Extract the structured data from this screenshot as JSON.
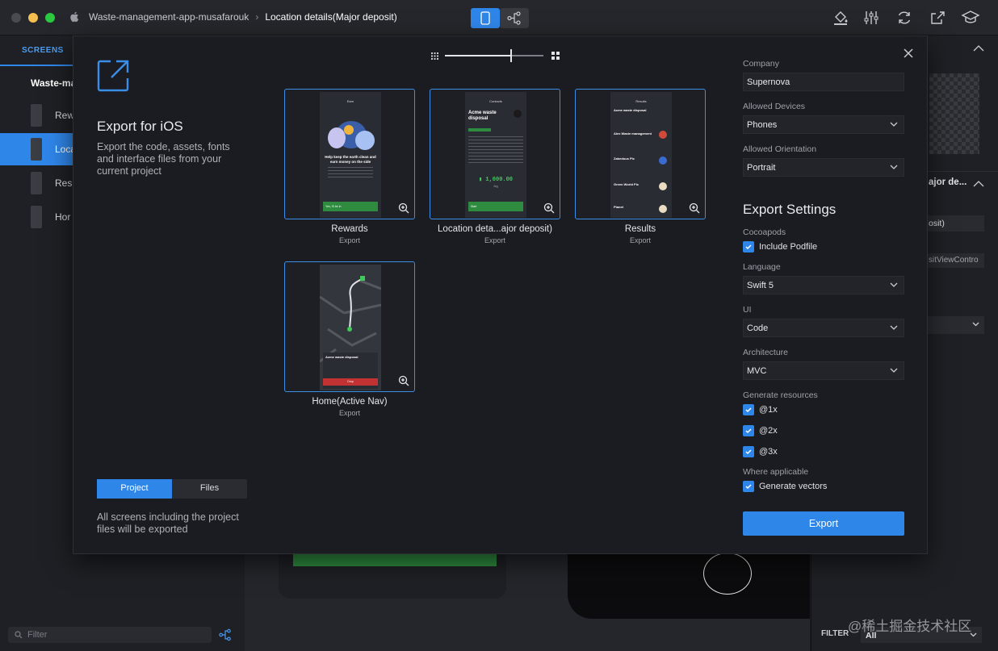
{
  "window": {
    "project_path": "Waste-management-app-musafarouk",
    "current_screen": "Location details(Major deposit)"
  },
  "left_panel": {
    "tab_label": "SCREENS",
    "project_name": "Waste-ma",
    "screens": [
      {
        "label": "Rew",
        "selected": false
      },
      {
        "label": "Loca",
        "selected": true
      },
      {
        "label": "Res",
        "selected": false
      },
      {
        "label": "Hor",
        "selected": false
      }
    ],
    "filter_placeholder": "Filter"
  },
  "right_panel_fragments": {
    "section_title": "ajor de...",
    "field1": "osit)",
    "field2": "sitViewContro"
  },
  "bottom_bar": {
    "filter_label": "FILTER",
    "filter_value": "All"
  },
  "watermark": "@稀土掘金技术社区",
  "modal": {
    "title": "Export for iOS",
    "description": "Export the code, assets, fonts and interface files from your current project",
    "segment": {
      "options": [
        "Project",
        "Files"
      ],
      "selected": "Project"
    },
    "segment_note": "All screens including the project files will be exported",
    "zoom_slider_value": 0.67,
    "screens": [
      {
        "name": "Rewards",
        "sub": "Export",
        "inner_title": "Earn",
        "inner_heading": "Help keep the earth clean and earn money on the side",
        "inner_button": "Yes, I'll be in"
      },
      {
        "name": "Location deta...ajor deposit)",
        "sub": "Export",
        "inner_title": "Contacts",
        "inner_heading": "Acme waste disposal",
        "inner_price": "1,000.00",
        "inner_unit": "/kg",
        "inner_button": "Start"
      },
      {
        "name": "Results",
        "sub": "Export",
        "inner_title": "Results",
        "inner_items": [
          "Acme waste disposal",
          "Alex Waste management",
          "Zabedous Plc",
          "Green World Plc",
          "Planet"
        ]
      },
      {
        "name": "Home(Active Nav)",
        "sub": "Export",
        "inner_heading": "Acme waste disposal",
        "inner_button": "Drop"
      }
    ]
  },
  "settings": {
    "company_label": "Company",
    "company_value": "Supernova",
    "devices_label": "Allowed Devices",
    "devices_value": "Phones",
    "orientation_label": "Allowed Orientation",
    "orientation_value": "Portrait",
    "export_settings_heading": "Export Settings",
    "cocoapods_label": "Cocoapods",
    "include_podfile": "Include Podfile",
    "language_label": "Language",
    "language_value": "Swift 5",
    "ui_label": "UI",
    "ui_value": "Code",
    "architecture_label": "Architecture",
    "architecture_value": "MVC",
    "resources_label": "Generate resources",
    "res_1x": "@1x",
    "res_2x": "@2x",
    "res_3x": "@3x",
    "applicable_label": "Where applicable",
    "generate_vectors": "Generate vectors",
    "export_button": "Export"
  }
}
